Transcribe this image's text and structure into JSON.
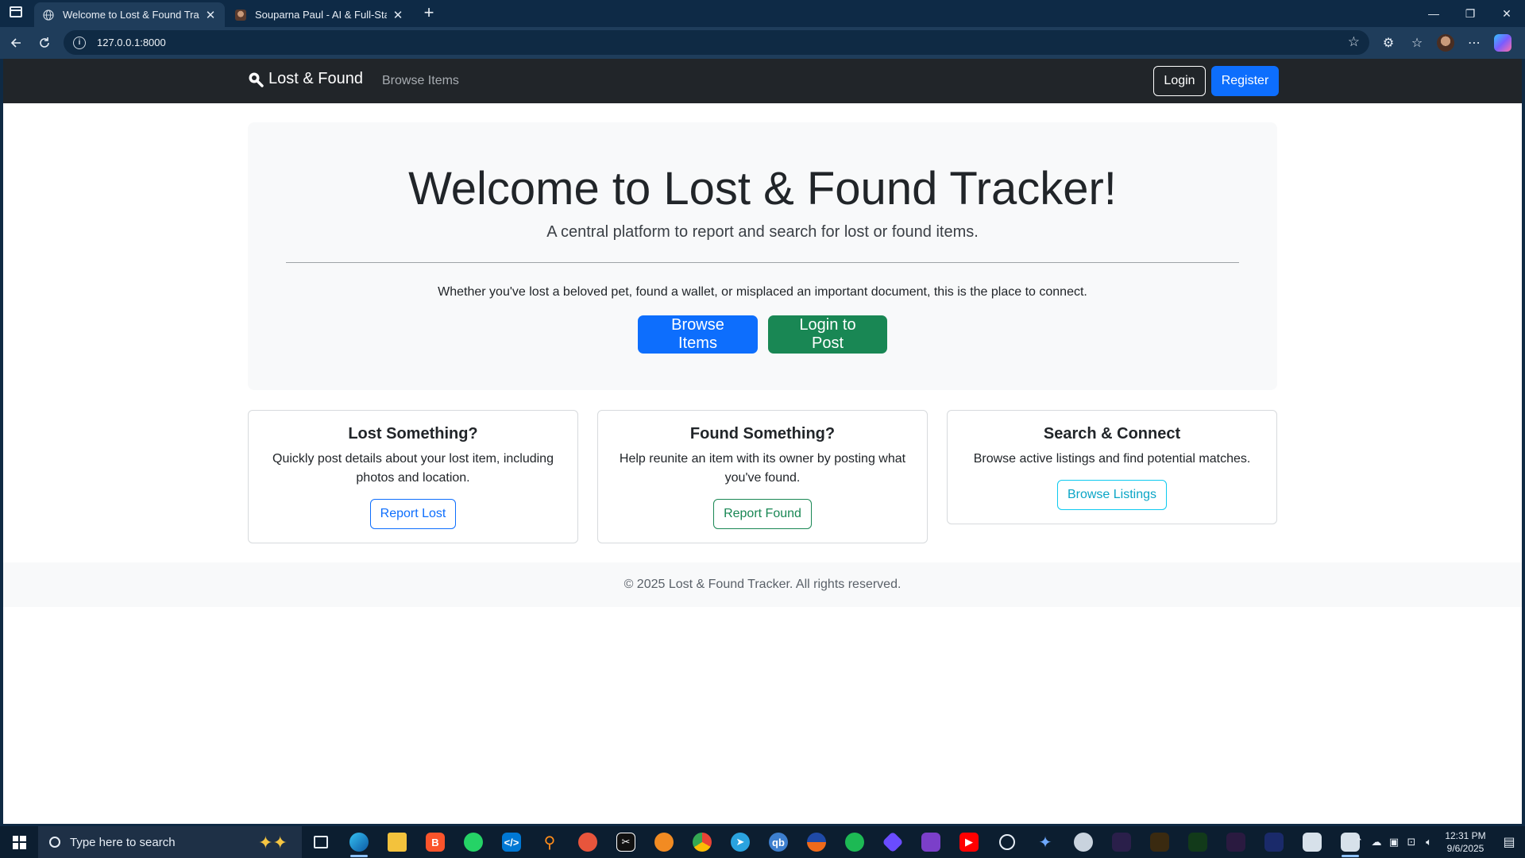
{
  "browser": {
    "tabs": [
      {
        "title": "Welcome to Lost & Found Tracker",
        "active": true
      },
      {
        "title": "Souparna Paul - AI & Full-Stack D",
        "active": false
      }
    ],
    "url": "127.0.0.1:8000"
  },
  "site": {
    "brand": "Lost & Found",
    "nav_link": "Browse Items",
    "login_label": "Login",
    "register_label": "Register"
  },
  "hero": {
    "title": "Welcome to Lost & Found Tracker!",
    "lead": "A central platform to report and search for lost or found items.",
    "description": "Whether you've lost a beloved pet, found a wallet, or misplaced an important document, this is the place to connect.",
    "browse_button": "Browse Items",
    "login_post_button": "Login to Post"
  },
  "cards": [
    {
      "title": "Lost Something?",
      "text": "Quickly post details about your lost item, including photos and location.",
      "button": "Report Lost"
    },
    {
      "title": "Found Something?",
      "text": "Help reunite an item with its owner by posting what you've found.",
      "button": "Report Found"
    },
    {
      "title": "Search & Connect",
      "text": "Browse active listings and find potential matches.",
      "button": "Browse Listings"
    }
  ],
  "footer": "© 2025 Lost & Found Tracker. All rights reserved.",
  "taskbar": {
    "search_placeholder": "Type here to search",
    "time": "12:31 PM",
    "date": "9/6/2025"
  },
  "colors": {
    "primary": "#0d6efd",
    "success": "#198754",
    "info": "#0dcaf0",
    "navbar": "#212529"
  }
}
